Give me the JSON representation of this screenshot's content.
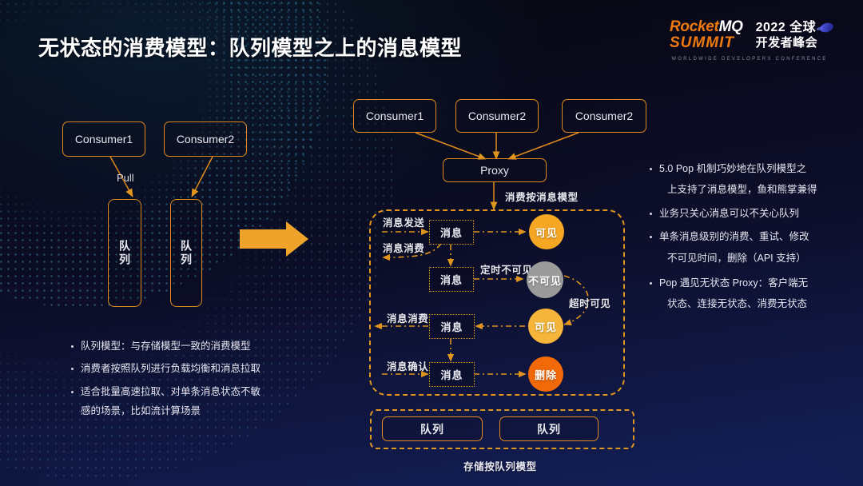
{
  "slide": {
    "title": "无状态的消费模型：队列模型之上的消息模型",
    "bg_top_color": "#07070c",
    "bg_bottom_color": "#13205a",
    "accent_color": "#e08a1e"
  },
  "logo": {
    "brand_prefix": "Rocket",
    "brand_suffix": "MQ",
    "brand_second_line": "SUMMIT",
    "year_line": "2022 全球",
    "cn_line": "开发者峰会",
    "tagline": "WORLDWIDE DEVELOPERS CONFERENCE",
    "globe_icon": "globe-icon"
  },
  "left_diagram": {
    "consumers": [
      {
        "label": "Consumer1"
      },
      {
        "label": "Consumer2"
      }
    ],
    "pull_label": "Pull",
    "queues": [
      {
        "label": "队列"
      },
      {
        "label": "队列"
      }
    ],
    "transition_arrow": "right-arrow-icon"
  },
  "left_bullets": [
    {
      "lines": [
        "队列模型：与存储模型一致的消费模型"
      ]
    },
    {
      "lines": [
        "消费者按照队列进行负载均衡和消息拉取"
      ]
    },
    {
      "lines": [
        "适合批量高速拉取、对单条消息状态不敏",
        "感的场景，比如流计算场景"
      ]
    }
  ],
  "right_diagram": {
    "consumers": [
      {
        "label": "Consumer1"
      },
      {
        "label": "Consumer2"
      },
      {
        "label": "Consumer2"
      }
    ],
    "proxy_label": "Proxy",
    "message_model_label": "消费按消息模型",
    "storage_model_label": "存储按队列模型",
    "message_box_label": "消息",
    "rows": [
      {
        "left_label": "消息发送",
        "message": "消息",
        "edge_label": "",
        "state": {
          "label": "可见",
          "color": "#f5a623"
        }
      },
      {
        "left_label": "消息消费",
        "message": "消息",
        "edge_label": "定时不可见",
        "state": {
          "label": "不可见",
          "color": "#9b9b9b"
        }
      },
      {
        "left_label": "消息消费",
        "message": "消息",
        "edge_label": "超时可见",
        "state": {
          "label": "可见",
          "color": "#f5b53a"
        }
      },
      {
        "left_label": "消息确认",
        "message": "消息",
        "edge_label": "",
        "state": {
          "label": "删除",
          "color": "#f2690a"
        }
      }
    ],
    "queues": [
      {
        "label": "队列"
      },
      {
        "label": "队列"
      }
    ]
  },
  "right_bullets": [
    {
      "lines": [
        "5.0 Pop 机制巧妙地在队列模型之",
        "上支持了消息模型，鱼和熊掌兼得"
      ]
    },
    {
      "lines": [
        "业务只关心消息可以不关心队列"
      ]
    },
    {
      "lines": [
        "单条消息级别的消费、重试、修改",
        "不可见时间，删除（API 支持）"
      ]
    },
    {
      "lines": [
        "Pop 遇见无状态 Proxy：客户端无",
        "状态、连接无状态、消费无状态"
      ]
    }
  ]
}
